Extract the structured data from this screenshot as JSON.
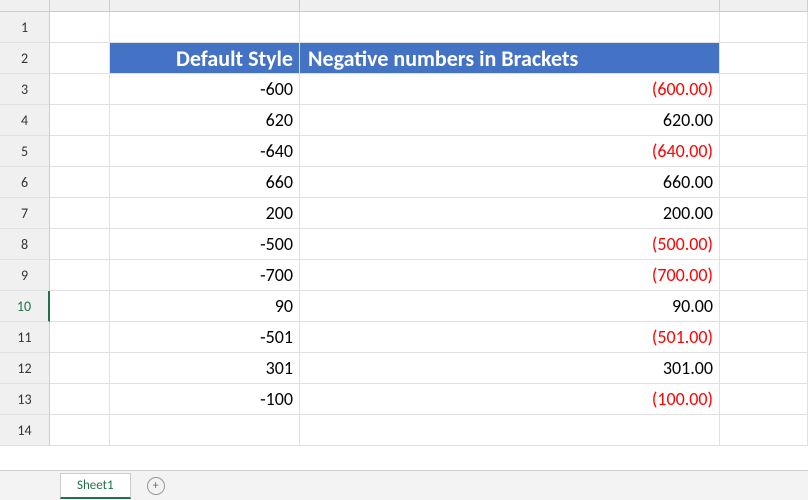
{
  "headers": {
    "col_b": "Default Style",
    "col_c": "Negative numbers in Brackets"
  },
  "rows": [
    {
      "num": "1",
      "b": "",
      "c": "",
      "neg": false
    },
    {
      "num": "2",
      "b": "",
      "c": "",
      "neg": false
    },
    {
      "num": "3",
      "b": "-600",
      "c": "(600.00)",
      "neg": true
    },
    {
      "num": "4",
      "b": "620",
      "c": "620.00",
      "neg": false
    },
    {
      "num": "5",
      "b": "-640",
      "c": "(640.00)",
      "neg": true
    },
    {
      "num": "6",
      "b": "660",
      "c": "660.00",
      "neg": false
    },
    {
      "num": "7",
      "b": "200",
      "c": "200.00",
      "neg": false
    },
    {
      "num": "8",
      "b": "-500",
      "c": "(500.00)",
      "neg": true
    },
    {
      "num": "9",
      "b": "-700",
      "c": "(700.00)",
      "neg": true
    },
    {
      "num": "10",
      "b": "90",
      "c": "90.00",
      "neg": false
    },
    {
      "num": "11",
      "b": "-501",
      "c": "(501.00)",
      "neg": true
    },
    {
      "num": "12",
      "b": "301",
      "c": "301.00",
      "neg": false
    },
    {
      "num": "13",
      "b": "-100",
      "c": "(100.00)",
      "neg": true
    },
    {
      "num": "14",
      "b": "",
      "c": "",
      "neg": false
    }
  ],
  "selected_row": "10",
  "sheet_tab": "Sheet1"
}
